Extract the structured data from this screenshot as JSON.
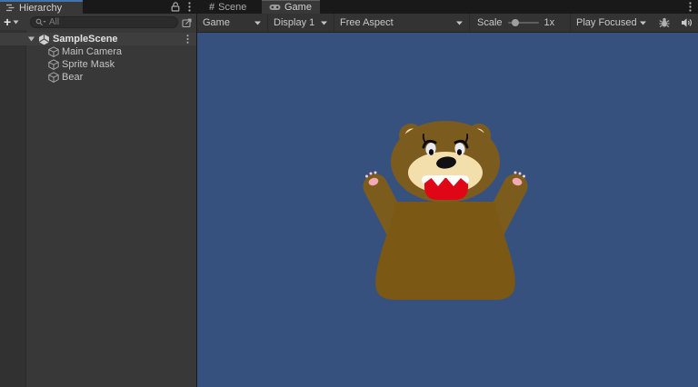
{
  "hierarchy_panel": {
    "tab_label": "Hierarchy",
    "toolbar": {
      "add_button": "+",
      "search_placeholder": "All"
    },
    "scene": {
      "name": "SampleScene",
      "children": [
        "Main Camera",
        "Sprite Mask",
        "Bear"
      ]
    }
  },
  "game_panel": {
    "tabs": {
      "scene": "Scene",
      "game": "Game"
    },
    "toolbar": {
      "mode": "Game",
      "display": "Display 1",
      "aspect": "Free Aspect",
      "scale_label": "Scale",
      "scale_value": "1x",
      "play_focused": "Play Focused"
    },
    "viewport": {
      "background_color": "#37517E",
      "bear_colors": {
        "fur": "#7C5C1E",
        "body": "#7B5814",
        "muzzle_cream": "#F2DFAC",
        "mouth_red": "#DF0716",
        "teeth": "#FFFFFF",
        "paw_pad_pink": "#F2AAB4",
        "nose_black": "#101012"
      }
    }
  }
}
